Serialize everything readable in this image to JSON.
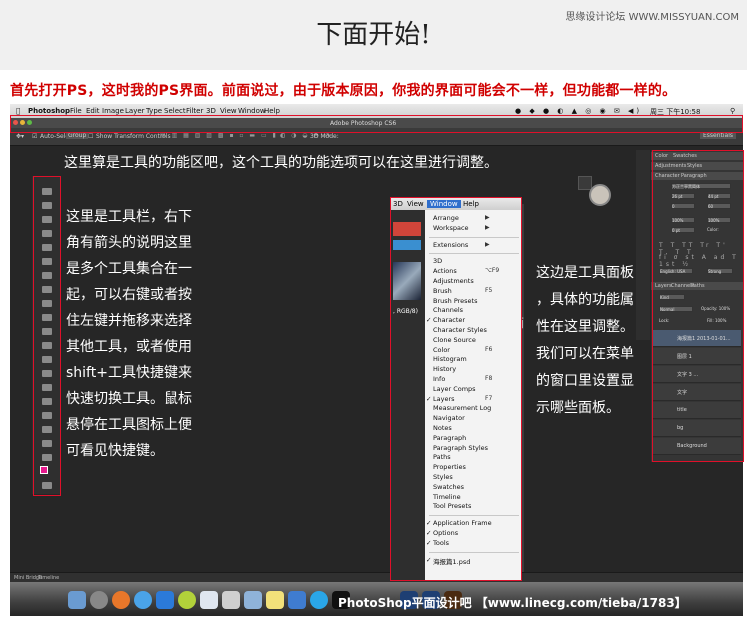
{
  "header": {
    "title": "下面开始!",
    "watermark": "思缘设计论坛 WWW.MISSYUAN.COM"
  },
  "intro": "首先打开PS，这时我的PS界面。前面说过，由于版本原因，你我的界面可能会不一样，但功能都一样的。",
  "ps_window": {
    "menubar": {
      "app": "Photoshop",
      "items": [
        "File",
        "Edit",
        "Image",
        "Layer",
        "Type",
        "Select",
        "Filter",
        "3D",
        "View",
        "Window",
        "Help"
      ],
      "clock": "周三 下午10:58"
    },
    "title": "Adobe Photoshop CS6",
    "options": {
      "auto_select": "Auto-Select:",
      "group": "Group",
      "transform": "Show Transform Controls",
      "mode3d": "3D Mode:",
      "workspace": "Essentials"
    },
    "status": [
      "Mini Bridge",
      "Timeline"
    ]
  },
  "annotations": {
    "options_note": "这里算是工具的功能区吧，这个工具的功能选项可以在这里进行调整。",
    "toolbar_note": [
      "这里是工具栏，右下",
      "角有箭头的说明这里",
      "是多个工具集合在一",
      "起，可以右键或者按",
      "住左键并拖移来选择",
      "其他工具，或者使用",
      "shift+工具快捷键来",
      "快速切换工具。鼠标",
      "悬停在工具图标上便",
      "可看见快捷键。"
    ],
    "panel_note": [
      "这边是工具面板",
      "，具体的功能属",
      "性在这里调整。",
      "我们可以在菜单",
      "的窗口里设置显",
      "示哪些面板。"
    ]
  },
  "window_menu": {
    "bar": [
      "3D",
      "View",
      "Window",
      "Help"
    ],
    "items": [
      {
        "label": "Arrange",
        "shortcut": "▶",
        "checked": false
      },
      {
        "label": "Workspace",
        "shortcut": "▶",
        "checked": false
      },
      {
        "label": "",
        "shortcut": "",
        "checked": false
      },
      {
        "label": "Extensions",
        "shortcut": "▶",
        "checked": false
      },
      {
        "label": "",
        "shortcut": "",
        "checked": false
      },
      {
        "label": "3D",
        "shortcut": "",
        "checked": false
      },
      {
        "label": "Actions",
        "shortcut": "⌥F9",
        "checked": false
      },
      {
        "label": "Adjustments",
        "shortcut": "",
        "checked": false
      },
      {
        "label": "Brush",
        "shortcut": "F5",
        "checked": false
      },
      {
        "label": "Brush Presets",
        "shortcut": "",
        "checked": false
      },
      {
        "label": "Channels",
        "shortcut": "",
        "checked": false
      },
      {
        "label": "Character",
        "shortcut": "",
        "checked": true
      },
      {
        "label": "Character Styles",
        "shortcut": "",
        "checked": false
      },
      {
        "label": "Clone Source",
        "shortcut": "",
        "checked": false
      },
      {
        "label": "Color",
        "shortcut": "F6",
        "checked": false
      },
      {
        "label": "Histogram",
        "shortcut": "",
        "checked": false
      },
      {
        "label": "History",
        "shortcut": "",
        "checked": false
      },
      {
        "label": "Info",
        "shortcut": "F8",
        "checked": false
      },
      {
        "label": "Layer Comps",
        "shortcut": "",
        "checked": false
      },
      {
        "label": "Layers",
        "shortcut": "F7",
        "checked": true
      },
      {
        "label": "Measurement Log",
        "shortcut": "",
        "checked": false
      },
      {
        "label": "Navigator",
        "shortcut": "",
        "checked": false
      },
      {
        "label": "Notes",
        "shortcut": "",
        "checked": false
      },
      {
        "label": "Paragraph",
        "shortcut": "",
        "checked": false
      },
      {
        "label": "Paragraph Styles",
        "shortcut": "",
        "checked": false
      },
      {
        "label": "Paths",
        "shortcut": "",
        "checked": false
      },
      {
        "label": "Properties",
        "shortcut": "",
        "checked": false
      },
      {
        "label": "Styles",
        "shortcut": "",
        "checked": false
      },
      {
        "label": "Swatches",
        "shortcut": "",
        "checked": false
      },
      {
        "label": "Timeline",
        "shortcut": "",
        "checked": false
      },
      {
        "label": "Tool Presets",
        "shortcut": "",
        "checked": false
      },
      {
        "label": "",
        "shortcut": "",
        "checked": false
      },
      {
        "label": "Application Frame",
        "shortcut": "",
        "checked": true
      },
      {
        "label": "Options",
        "shortcut": "",
        "checked": true
      },
      {
        "label": "Tools",
        "shortcut": "",
        "checked": true
      },
      {
        "label": "",
        "shortcut": "",
        "checked": false
      },
      {
        "label": "海报篇1.psd",
        "shortcut": "",
        "checked": true
      }
    ]
  },
  "right_panel": {
    "tabs1": [
      "Color",
      "Swatches"
    ],
    "tabs2": [
      "Adjustments",
      "Styles"
    ],
    "tabs3": [
      "Character",
      "Paragraph"
    ],
    "font": "方正兰亭黑简体",
    "size": "26 pt",
    "leading": "44 pt",
    "tracking": "0",
    "kerning": "60",
    "scale_v": "100%",
    "scale_h": "100%",
    "baseline": "0 pt",
    "color_label": "Color:",
    "language": "English: USA",
    "aa": "Strong",
    "layers_tabs": [
      "Layers",
      "Channels",
      "Paths"
    ],
    "kind": "Kind",
    "blend": "Normal",
    "opacity": "Opacity: 100%",
    "lock": "Lock:",
    "fill": "Fill: 100%",
    "layers": [
      "海报篇1 2013-01-01...",
      "图层 1",
      "文字 3 ...",
      "文字",
      "title",
      "bg",
      "Background"
    ]
  },
  "dock_caption": "PhotoShop平面设计吧 【www.linecg.com/tieba/1783】"
}
